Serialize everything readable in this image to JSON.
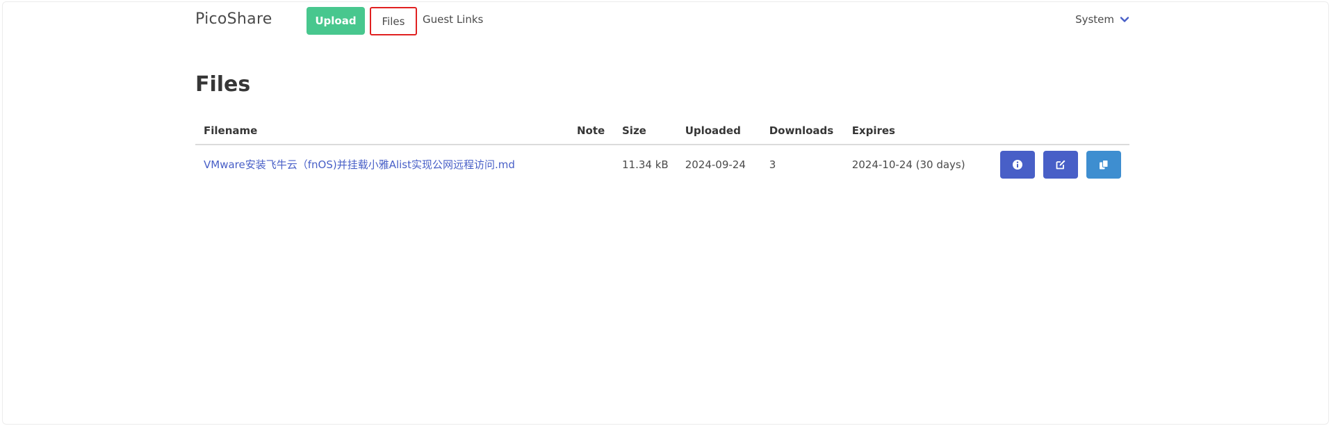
{
  "navbar": {
    "brand": "PicoShare",
    "upload_label": "Upload",
    "files_label": "Files",
    "guest_links_label": "Guest Links",
    "system_label": "System"
  },
  "page": {
    "title": "Files"
  },
  "table": {
    "headers": [
      "Filename",
      "Note",
      "Size",
      "Uploaded",
      "Downloads",
      "Expires"
    ],
    "rows": [
      {
        "filename": "VMware安装飞牛云（fnOS)并挂载小雅Alist实现公网远程访问.md",
        "note": "",
        "size": "11.34 kB",
        "uploaded": "2024-09-24",
        "downloads": "3",
        "expires": "2024-10-24 (30 days)"
      }
    ]
  },
  "icons": {
    "info": "info-circle-icon",
    "edit": "edit-icon",
    "copy": "copy-icon",
    "system_dropdown": "chevron-down-icon"
  },
  "colors": {
    "upload_button": "#48c78e",
    "link": "#485fc7",
    "info_button": "#485fc7",
    "edit_button": "#485fc7",
    "copy_button": "#3e8ed0",
    "highlight_box": "#e02020"
  }
}
